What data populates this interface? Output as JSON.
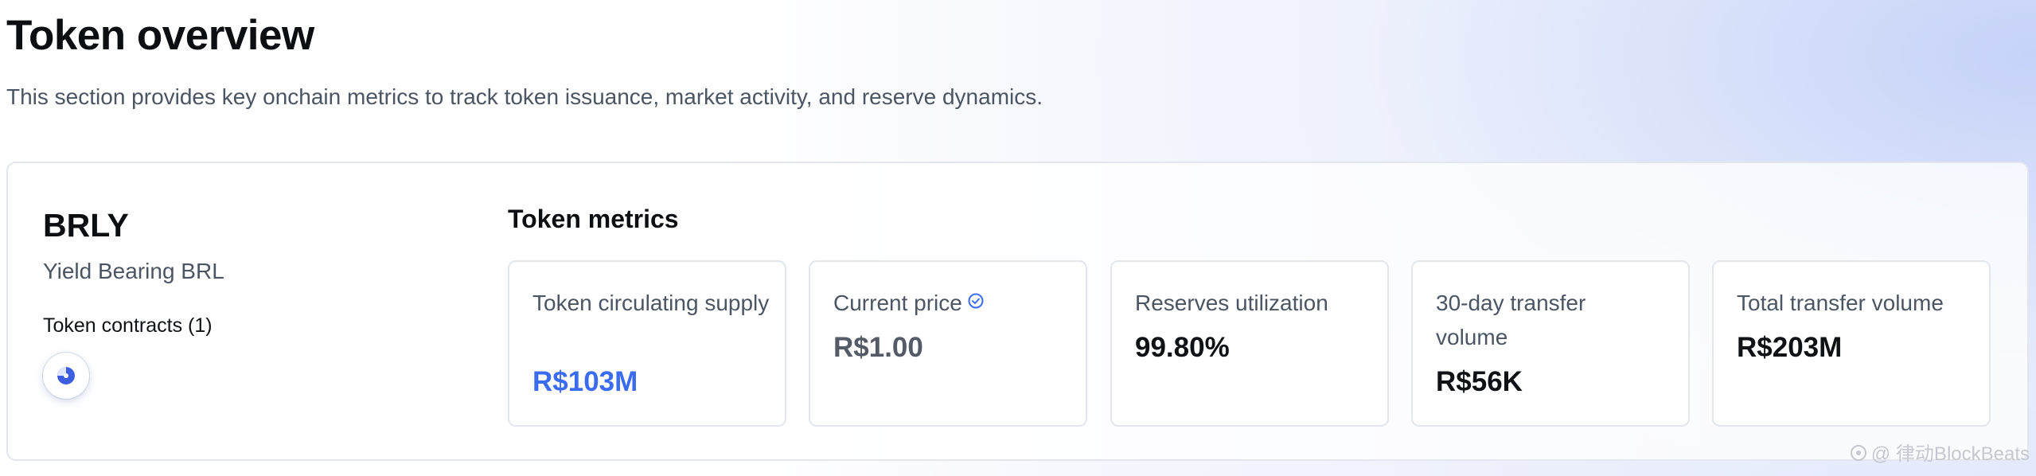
{
  "header": {
    "title": "Token overview",
    "subtitle": "This section provides key onchain metrics to track token issuance, market activity, and reserve dynamics."
  },
  "token": {
    "symbol": "BRLY",
    "name": "Yield Bearing BRL",
    "contracts_label": "Token contracts (1)",
    "contract_icon": "blockchain-network-icon"
  },
  "metrics": {
    "title": "Token metrics",
    "items": [
      {
        "label": "Token circulating supply",
        "value": "R$103M",
        "value_color": "#3b6cf0"
      },
      {
        "label": "Current price",
        "value": "R$1.00",
        "value_color": "#555b66",
        "icon": "verified-check-icon"
      },
      {
        "label": "Reserves utilization",
        "value": "99.80%",
        "value_color": "#0f1115"
      },
      {
        "label": "30-day transfer volume",
        "value": "R$56K",
        "value_color": "#0f1115"
      },
      {
        "label": "Total transfer volume",
        "value": "R$203M",
        "value_color": "#0f1115"
      }
    ]
  },
  "watermark": {
    "text": "@ 律动BlockBeats",
    "icon": "watermark-logo-icon"
  },
  "colors": {
    "accent": "#3b6cf0",
    "card_border": "#e3e6ee",
    "muted_text": "#4b5563"
  }
}
